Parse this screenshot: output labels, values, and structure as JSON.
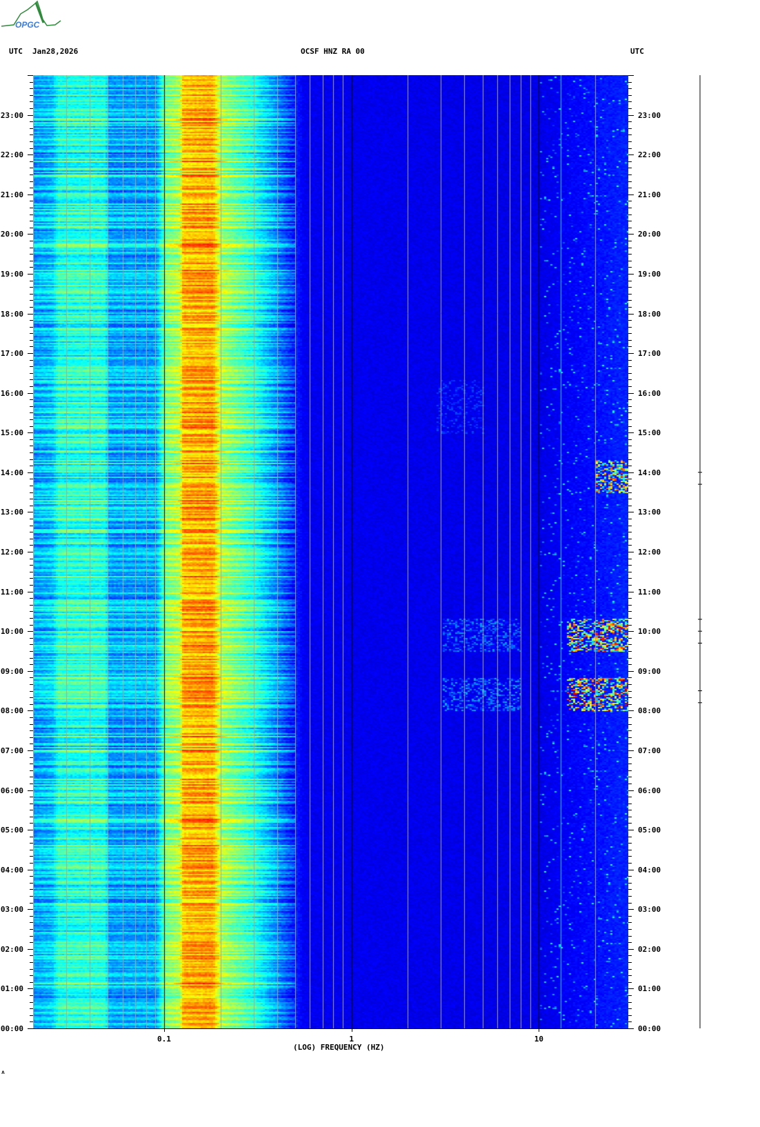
{
  "logo": {
    "text": "OPGC",
    "colors": {
      "mountain": "#2e8b3a",
      "text": "#3a7be0"
    }
  },
  "header": {
    "left_label": "UTC",
    "date": "Jan28,2026",
    "station": "OCSF HNZ RA 00",
    "right_label": "UTC"
  },
  "footer_mark": "ʌ",
  "chart_data": {
    "type": "heatmap",
    "title": "OCSF HNZ RA 00",
    "xlabel": "(LOG) FREQUENCY (HZ)",
    "ylabel": "UTC",
    "x_scale": "log",
    "xlim": [
      0.02,
      30
    ],
    "ylim_hours": [
      0,
      24
    ],
    "x_tick_values": [
      0.1,
      1,
      10
    ],
    "x_tick_labels": [
      "0.1",
      "1",
      "10"
    ],
    "y_tick_labels": [
      "00:00",
      "01:00",
      "02:00",
      "03:00",
      "04:00",
      "05:00",
      "06:00",
      "07:00",
      "08:00",
      "09:00",
      "10:00",
      "11:00",
      "12:00",
      "13:00",
      "14:00",
      "15:00",
      "16:00",
      "17:00",
      "18:00",
      "19:00",
      "20:00",
      "21:00",
      "22:00",
      "23:00"
    ],
    "minor_tick_minutes": 10,
    "grid": "vertical gridlines at 2-9 x each decade; black at decades",
    "colormap": "jet",
    "mean_profile": [
      {
        "f": 0.02,
        "level": 0.3
      },
      {
        "f": 0.025,
        "level": 0.33
      },
      {
        "f": 0.027,
        "level": 0.42
      },
      {
        "f": 0.048,
        "level": 0.42
      },
      {
        "f": 0.05,
        "level": 0.3
      },
      {
        "f": 0.09,
        "level": 0.3
      },
      {
        "f": 0.1,
        "level": 0.5
      },
      {
        "f": 0.12,
        "level": 0.56
      },
      {
        "f": 0.125,
        "level": 0.7
      },
      {
        "f": 0.18,
        "level": 0.72
      },
      {
        "f": 0.2,
        "level": 0.55
      },
      {
        "f": 0.3,
        "level": 0.42
      },
      {
        "f": 0.42,
        "level": 0.25
      },
      {
        "f": 0.55,
        "level": 0.11
      },
      {
        "f": 10,
        "level": 0.1
      },
      {
        "f": 30,
        "level": 0.16
      }
    ],
    "events": [
      {
        "start": "08:00",
        "end": "08:50",
        "fmin": 14,
        "fmax": 30,
        "peak": 0.95
      },
      {
        "start": "09:30",
        "end": "10:20",
        "fmin": 14,
        "fmax": 30,
        "peak": 0.9
      },
      {
        "start": "13:30",
        "end": "14:20",
        "fmin": 20,
        "fmax": 30,
        "peak": 0.85
      },
      {
        "start": "08:00",
        "end": "08:50",
        "fmin": 3,
        "fmax": 8,
        "peak": 0.3
      },
      {
        "start": "09:30",
        "end": "10:20",
        "fmin": 3,
        "fmax": 8,
        "peak": 0.28
      },
      {
        "start": "15:00",
        "end": "16:20",
        "fmin": 2.8,
        "fmax": 5,
        "peak": 0.2
      }
    ],
    "seismogram_bursts_hours": [
      8.2,
      8.5,
      9.7,
      10.0,
      10.3,
      13.7,
      14.0
    ]
  }
}
